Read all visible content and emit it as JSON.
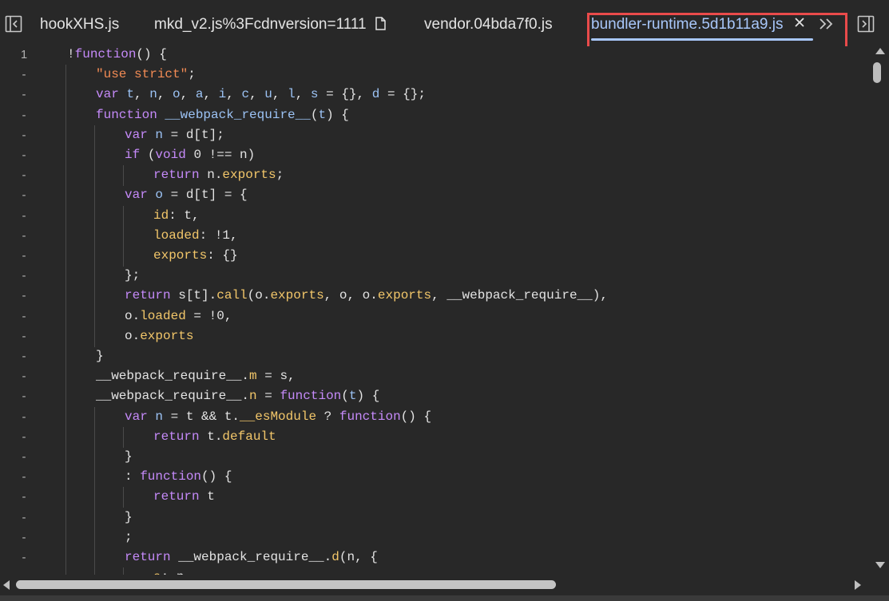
{
  "tabs": [
    {
      "label": "hookXHS.js",
      "active": false
    },
    {
      "label": "mkd_v2.js%3Fcdnversion=1111",
      "active": false
    },
    {
      "label": "vendor.04bda7f0.js",
      "active": false
    },
    {
      "label": "bundler-runtime.5d1b11a9.js",
      "active": true
    }
  ],
  "icons": {
    "left_panel": "toggle-left-sidebar-icon",
    "file": "document-icon",
    "close": "close-icon",
    "overflow": "chevron-double-right-icon",
    "right_panel": "toggle-right-sidebar-icon"
  },
  "colors": {
    "background": "#282828",
    "keyword": "#c58af9",
    "property": "#f3c76a",
    "identifier": "#9cc3f5",
    "string": "#f28b54",
    "text": "#e3e3e3",
    "active_tab": "#a8c7fa",
    "highlight_box": "#e94b4b"
  },
  "code": [
    {
      "num": "1",
      "indent": 0,
      "tokens": [
        [
          "!",
          "pun"
        ],
        [
          "function",
          "kw"
        ],
        [
          "() {",
          "pun"
        ]
      ]
    },
    {
      "num": "-",
      "indent": 1,
      "tokens": [
        [
          "\"use strict\"",
          "str"
        ],
        [
          ";",
          "pun"
        ]
      ]
    },
    {
      "num": "-",
      "indent": 1,
      "tokens": [
        [
          "var ",
          "kw"
        ],
        [
          "t",
          "var"
        ],
        [
          ", ",
          "pun"
        ],
        [
          "n",
          "var"
        ],
        [
          ", ",
          "pun"
        ],
        [
          "o",
          "var"
        ],
        [
          ", ",
          "pun"
        ],
        [
          "a",
          "var"
        ],
        [
          ", ",
          "pun"
        ],
        [
          "i",
          "var"
        ],
        [
          ", ",
          "pun"
        ],
        [
          "c",
          "var"
        ],
        [
          ", ",
          "pun"
        ],
        [
          "u",
          "var"
        ],
        [
          ", ",
          "pun"
        ],
        [
          "l",
          "var"
        ],
        [
          ", ",
          "pun"
        ],
        [
          "s",
          "var"
        ],
        [
          " = {}, ",
          "pun"
        ],
        [
          "d",
          "var"
        ],
        [
          " = {};",
          "pun"
        ]
      ]
    },
    {
      "num": "-",
      "indent": 1,
      "tokens": [
        [
          "function ",
          "kw"
        ],
        [
          "__webpack_require__",
          "var"
        ],
        [
          "(",
          "pun"
        ],
        [
          "t",
          "var"
        ],
        [
          ") {",
          "pun"
        ]
      ]
    },
    {
      "num": "-",
      "indent": 2,
      "tokens": [
        [
          "var ",
          "kw"
        ],
        [
          "n",
          "var"
        ],
        [
          " = d[t];",
          "pun"
        ]
      ]
    },
    {
      "num": "-",
      "indent": 2,
      "tokens": [
        [
          "if ",
          "kw"
        ],
        [
          "(",
          "pun"
        ],
        [
          "void ",
          "kw"
        ],
        [
          "0 !== n)",
          "pun"
        ]
      ]
    },
    {
      "num": "-",
      "indent": 3,
      "tokens": [
        [
          "return ",
          "kw"
        ],
        [
          "n.",
          "pun"
        ],
        [
          "exports",
          "prop"
        ],
        [
          ";",
          "pun"
        ]
      ]
    },
    {
      "num": "-",
      "indent": 2,
      "tokens": [
        [
          "var ",
          "kw"
        ],
        [
          "o",
          "var"
        ],
        [
          " = d[t] = {",
          "pun"
        ]
      ]
    },
    {
      "num": "-",
      "indent": 3,
      "tokens": [
        [
          "id",
          "prop"
        ],
        [
          ": t,",
          "pun"
        ]
      ]
    },
    {
      "num": "-",
      "indent": 3,
      "tokens": [
        [
          "loaded",
          "prop"
        ],
        [
          ": !1,",
          "pun"
        ]
      ]
    },
    {
      "num": "-",
      "indent": 3,
      "tokens": [
        [
          "exports",
          "prop"
        ],
        [
          ": {}",
          "pun"
        ]
      ]
    },
    {
      "num": "-",
      "indent": 2,
      "tokens": [
        [
          "};",
          "pun"
        ]
      ]
    },
    {
      "num": "-",
      "indent": 2,
      "tokens": [
        [
          "return ",
          "kw"
        ],
        [
          "s[t].",
          "pun"
        ],
        [
          "call",
          "prop"
        ],
        [
          "(o.",
          "pun"
        ],
        [
          "exports",
          "prop"
        ],
        [
          ", o, o.",
          "pun"
        ],
        [
          "exports",
          "prop"
        ],
        [
          ", __webpack_require__),",
          "pun"
        ]
      ]
    },
    {
      "num": "-",
      "indent": 2,
      "tokens": [
        [
          "o.",
          "pun"
        ],
        [
          "loaded",
          "prop"
        ],
        [
          " = !0,",
          "pun"
        ]
      ]
    },
    {
      "num": "-",
      "indent": 2,
      "tokens": [
        [
          "o.",
          "pun"
        ],
        [
          "exports",
          "prop"
        ]
      ]
    },
    {
      "num": "-",
      "indent": 1,
      "tokens": [
        [
          "}",
          "pun"
        ]
      ]
    },
    {
      "num": "-",
      "indent": 1,
      "tokens": [
        [
          "__webpack_require__.",
          "pun"
        ],
        [
          "m",
          "prop"
        ],
        [
          " = s,",
          "pun"
        ]
      ]
    },
    {
      "num": "-",
      "indent": 1,
      "tokens": [
        [
          "__webpack_require__.",
          "pun"
        ],
        [
          "n",
          "prop"
        ],
        [
          " = ",
          "pun"
        ],
        [
          "function",
          "kw"
        ],
        [
          "(",
          "pun"
        ],
        [
          "t",
          "var"
        ],
        [
          ") {",
          "pun"
        ]
      ]
    },
    {
      "num": "-",
      "indent": 2,
      "tokens": [
        [
          "var ",
          "kw"
        ],
        [
          "n",
          "var"
        ],
        [
          " = t && t.",
          "pun"
        ],
        [
          "__esModule",
          "prop"
        ],
        [
          " ? ",
          "pun"
        ],
        [
          "function",
          "kw"
        ],
        [
          "() {",
          "pun"
        ]
      ]
    },
    {
      "num": "-",
      "indent": 3,
      "tokens": [
        [
          "return ",
          "kw"
        ],
        [
          "t.",
          "pun"
        ],
        [
          "default",
          "prop"
        ]
      ]
    },
    {
      "num": "-",
      "indent": 2,
      "tokens": [
        [
          "}",
          "pun"
        ]
      ]
    },
    {
      "num": "-",
      "indent": 2,
      "tokens": [
        [
          ": ",
          "pun"
        ],
        [
          "function",
          "kw"
        ],
        [
          "() {",
          "pun"
        ]
      ]
    },
    {
      "num": "-",
      "indent": 3,
      "tokens": [
        [
          "return ",
          "kw"
        ],
        [
          "t",
          "pun"
        ]
      ]
    },
    {
      "num": "-",
      "indent": 2,
      "tokens": [
        [
          "}",
          "pun"
        ]
      ]
    },
    {
      "num": "-",
      "indent": 2,
      "tokens": [
        [
          ";",
          "pun"
        ]
      ]
    },
    {
      "num": "-",
      "indent": 2,
      "tokens": [
        [
          "return ",
          "kw"
        ],
        [
          "__webpack_require__.",
          "pun"
        ],
        [
          "d",
          "prop"
        ],
        [
          "(n, {",
          "pun"
        ]
      ]
    },
    {
      "num": "-",
      "indent": 3,
      "tokens": [
        [
          "a",
          "prop"
        ],
        [
          ": n",
          "pun"
        ]
      ]
    }
  ]
}
